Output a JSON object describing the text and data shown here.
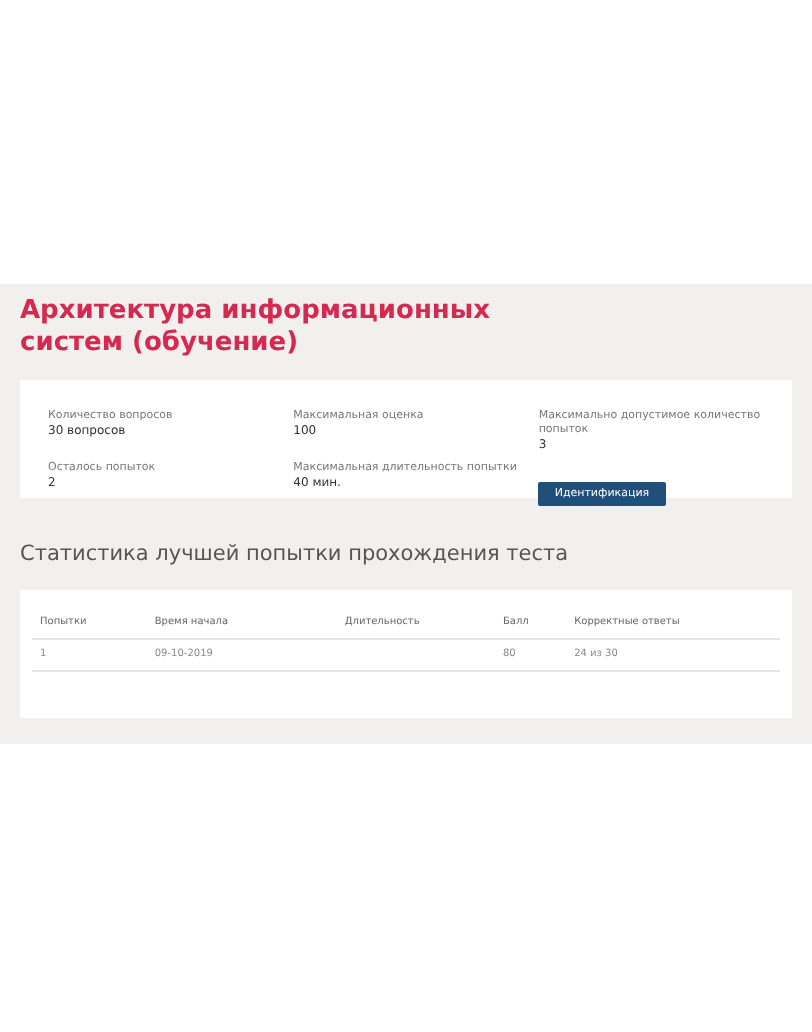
{
  "title": "Архитектура информационных систем (обучение)",
  "info": [
    {
      "label": "Количество вопросов",
      "value": "30 вопросов"
    },
    {
      "label": "Максимальная оценка",
      "value": "100"
    },
    {
      "label": "Максимально допустимое количество попыток",
      "value": "3"
    },
    {
      "label": "Осталось попыток",
      "value": "2"
    },
    {
      "label": "Максимальная длительность попытки",
      "value": "40 мин."
    }
  ],
  "identify_button": "Идентификация",
  "stats_heading": "Статистика лучшей попытки прохождения теста",
  "table": {
    "columns": [
      "Попытки",
      "Время начала",
      "Длительность",
      "Балл",
      "Корректные ответы"
    ],
    "rows": [
      [
        "1",
        "09-10-2019",
        "",
        "80",
        "24 из 30"
      ]
    ]
  }
}
